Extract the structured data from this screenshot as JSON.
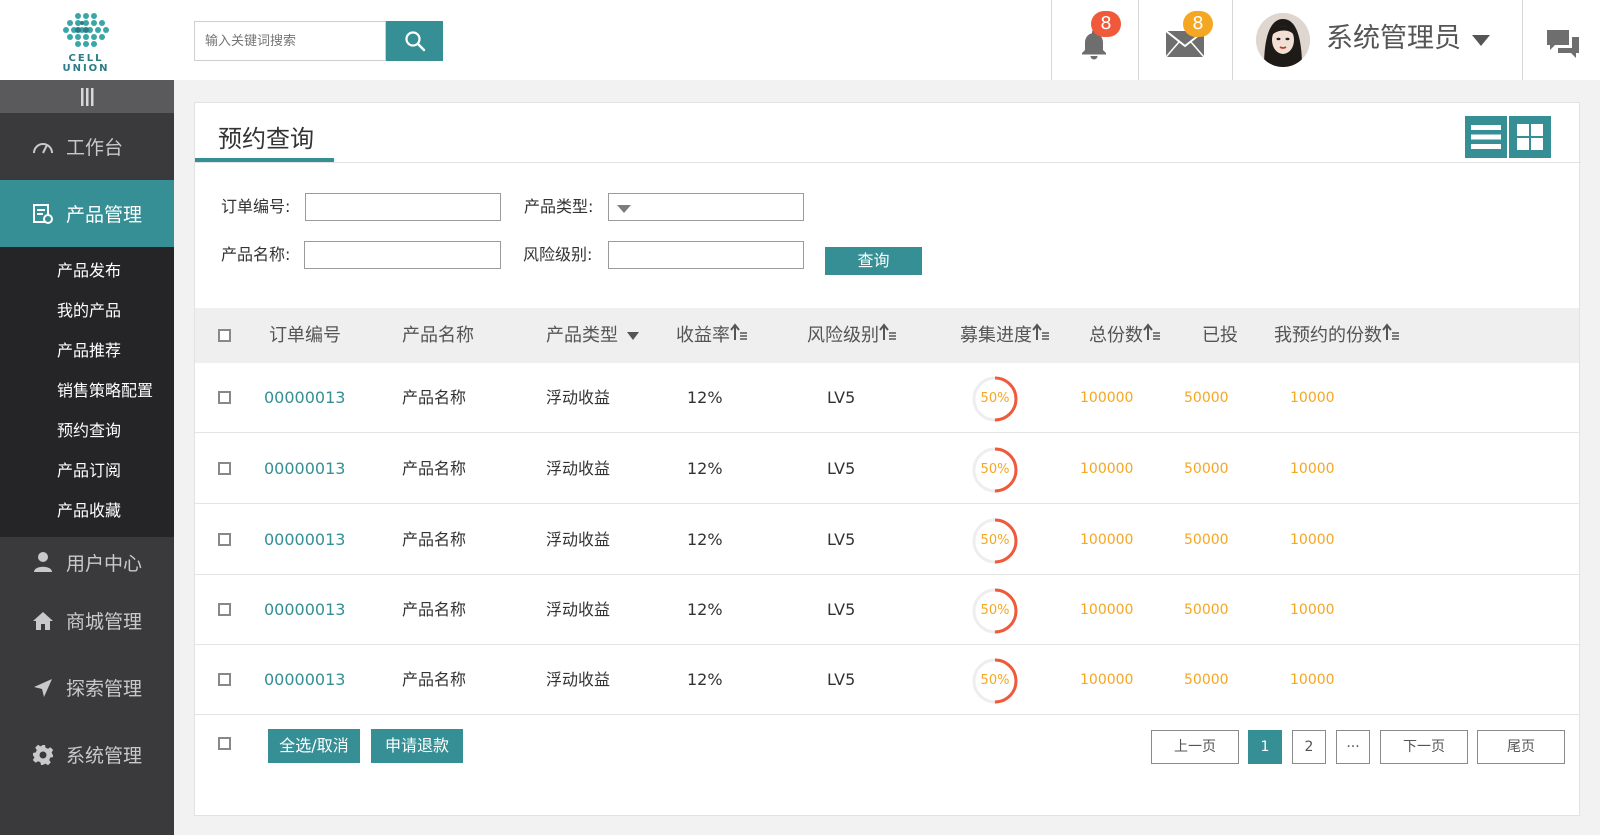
{
  "header": {
    "logo_text_1": "CELL",
    "logo_text_2": "UNION",
    "search_placeholder": "输入关键词搜索",
    "notification_count": "8",
    "message_count": "8",
    "user_name": "系统管理员"
  },
  "sidebar": {
    "items": [
      {
        "label": "工作台",
        "icon": "dashboard-icon"
      },
      {
        "label": "产品管理",
        "icon": "product-icon"
      },
      {
        "label": "用户中心",
        "icon": "user-icon"
      },
      {
        "label": "商城管理",
        "icon": "home-icon"
      },
      {
        "label": "探索管理",
        "icon": "navigation-icon"
      },
      {
        "label": "系统管理",
        "icon": "gear-icon"
      }
    ],
    "sub_items": [
      "产品发布",
      "我的产品",
      "产品推荐",
      "销售策略配置",
      "预约查询",
      "产品订阅",
      "产品收藏"
    ]
  },
  "panel": {
    "title": "预约查询"
  },
  "filters": {
    "order_no_label": "订单编号:",
    "product_type_label": "产品类型:",
    "product_name_label": "产品名称:",
    "risk_level_label": "风险级别:",
    "query_button": "查询"
  },
  "table": {
    "headers": [
      "订单编号",
      "产品名称",
      "产品类型",
      "收益率",
      "风险级别",
      "募集进度",
      "总份数",
      "已投",
      "我预约的份数"
    ],
    "rows": [
      {
        "order_no": "00000013",
        "name": "产品名称",
        "type": "浮动收益",
        "rate": "12%",
        "risk": "LV5",
        "progress_label": "50%",
        "progress": 0.5,
        "total": "100000",
        "invested": "50000",
        "reserved": "10000"
      },
      {
        "order_no": "00000013",
        "name": "产品名称",
        "type": "浮动收益",
        "rate": "12%",
        "risk": "LV5",
        "progress_label": "50%",
        "progress": 0.5,
        "total": "100000",
        "invested": "50000",
        "reserved": "10000"
      },
      {
        "order_no": "00000013",
        "name": "产品名称",
        "type": "浮动收益",
        "rate": "12%",
        "risk": "LV5",
        "progress_label": "50%",
        "progress": 0.5,
        "total": "100000",
        "invested": "50000",
        "reserved": "10000"
      },
      {
        "order_no": "00000013",
        "name": "产品名称",
        "type": "浮动收益",
        "rate": "12%",
        "risk": "LV5",
        "progress_label": "50%",
        "progress": 0.5,
        "total": "100000",
        "invested": "50000",
        "reserved": "10000"
      },
      {
        "order_no": "00000013",
        "name": "产品名称",
        "type": "浮动收益",
        "rate": "12%",
        "risk": "LV5",
        "progress_label": "50%",
        "progress": 0.5,
        "total": "100000",
        "invested": "50000",
        "reserved": "10000"
      }
    ]
  },
  "footer": {
    "select_all": "全选/取消",
    "refund": "申请退款"
  },
  "pagination": {
    "prev": "上一页",
    "page_1": "1",
    "page_2": "2",
    "ellipsis": "···",
    "next": "下一页",
    "last": "尾页"
  },
  "colors": {
    "accent": "#358f95",
    "sidebar_bg": "#3a3a3c",
    "notification_badge": "#f05a3a",
    "message_badge": "#f5a623",
    "progress_ring": "#f05a3a",
    "value_orange": "#f5a623"
  }
}
